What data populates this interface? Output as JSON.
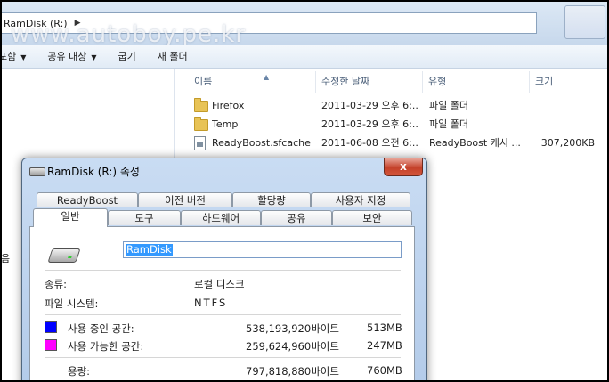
{
  "explorer": {
    "address_path": "RamDisk (R:)",
    "watermark": "www.autoboy.pe.kr",
    "toolbar": {
      "include": "포함",
      "share": "공유 대상",
      "burn": "굽기",
      "new_folder": "새 폴더"
    },
    "left_fragment": "음",
    "columns": {
      "name": "이름",
      "date": "수정한 날짜",
      "type": "유형",
      "size": "크기"
    },
    "files": [
      {
        "name": "Firefox",
        "date": "2011-03-29 오후 6:...",
        "type": "파일 폴더",
        "size": ""
      },
      {
        "name": "Temp",
        "date": "2011-03-29 오후 6:...",
        "type": "파일 폴더",
        "size": ""
      },
      {
        "name": "ReadyBoost.sfcache",
        "date": "2011-06-08 오전 6:...",
        "type": "ReadyBoost 캐시 ...",
        "size": "307,200KB"
      }
    ]
  },
  "dialog": {
    "title": "RamDisk (R:) 속성",
    "close_label": "x",
    "tabs_back": [
      "ReadyBoost",
      "이전 버전",
      "할당량",
      "사용자 지정"
    ],
    "tabs_front": [
      "일반",
      "도구",
      "하드웨어",
      "공유",
      "보안"
    ],
    "volume_name": "RamDisk",
    "type_label": "종류:",
    "type_value": "로컬 디스크",
    "fs_label": "파일 시스템:",
    "fs_value": "NTFS",
    "used_label": "사용 중인 공간:",
    "used_bytes": "538,193,920바이트",
    "used_mb": "513MB",
    "free_label": "사용 가능한 공간:",
    "free_bytes": "259,624,960바이트",
    "free_mb": "247MB",
    "capacity_label": "용량:",
    "capacity_bytes": "797,818,880바이트",
    "capacity_mb": "760MB",
    "colors": {
      "used": "#0000ff",
      "free": "#ff00ff"
    }
  }
}
